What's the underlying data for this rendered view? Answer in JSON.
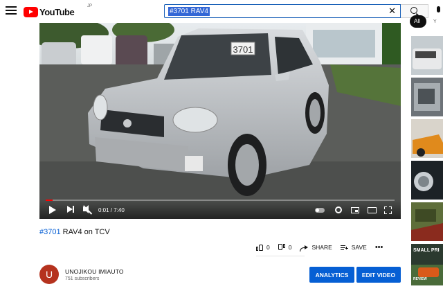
{
  "header": {
    "logo_text": "YouTube",
    "country_code": "JP",
    "search_value": "#3701 RAV4",
    "clear_symbol": "✕",
    "icons": [
      "menu-icon",
      "search-icon",
      "mic-icon"
    ]
  },
  "player": {
    "time_display": "0:01 / 7:40",
    "plate_text": "3701",
    "progress_fraction": 0.002,
    "icons": [
      "play-icon",
      "next-icon",
      "mute-icon",
      "autoplay-toggle-icon",
      "settings-gear-icon",
      "miniplayer-icon",
      "theater-icon",
      "fullscreen-icon"
    ]
  },
  "video": {
    "title_tag": "#3701",
    "title_rest": " RAV4 on TCV"
  },
  "actions": {
    "like_count": "0",
    "dislike_count": "0",
    "share_label": "SHARE",
    "save_label": "SAVE",
    "more_symbol": "•••"
  },
  "channel": {
    "avatar_letter": "U",
    "name": "UNOJIKOU IMIAUTO",
    "subscribers": "751 subscribers",
    "avatar_color": "#b5321e"
  },
  "buttons": {
    "analytics_label": "ANALYTICS",
    "edit_label": "EDIT VIDEO",
    "accent_color": "#065fd4"
  },
  "sidebar": {
    "chip_label": "All",
    "chip2_label": "Y",
    "thumbnail_overlay_text": "SMALL PRI",
    "thumbnail_overlay_text2": "REVIEW"
  }
}
